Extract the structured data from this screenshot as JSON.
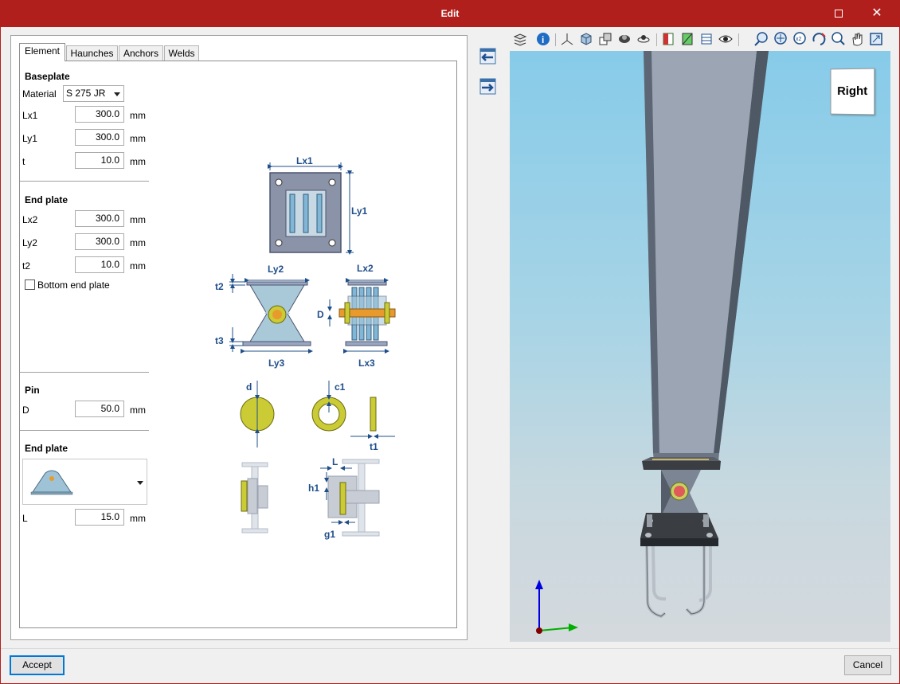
{
  "window": {
    "title": "Edit"
  },
  "tabs": [
    "Element",
    "Haunches",
    "Anchors",
    "Welds"
  ],
  "baseplate": {
    "title": "Baseplate",
    "material_label": "Material",
    "material_value": "S 275 JR",
    "fields": [
      {
        "label": "Lx1",
        "value": "300.0",
        "unit": "mm"
      },
      {
        "label": "Ly1",
        "value": "300.0",
        "unit": "mm"
      },
      {
        "label": "t",
        "value": "10.0",
        "unit": "mm"
      }
    ]
  },
  "end_plate": {
    "title": "End plate",
    "fields": [
      {
        "label": "Lx2",
        "value": "300.0",
        "unit": "mm"
      },
      {
        "label": "Ly2",
        "value": "300.0",
        "unit": "mm"
      },
      {
        "label": "t2",
        "value": "10.0",
        "unit": "mm"
      }
    ],
    "bottom_label": "Bottom end plate"
  },
  "pin": {
    "title": "Pin",
    "fields": [
      {
        "label": "D",
        "value": "50.0",
        "unit": "mm"
      }
    ]
  },
  "end_plate_shape": {
    "title": "End plate",
    "fields": [
      {
        "label": "L",
        "value": "15.0",
        "unit": "mm"
      }
    ]
  },
  "diagram": {
    "lx1": "Lx1",
    "ly1": "Ly1",
    "ly2": "Ly2",
    "lx2": "Lx2",
    "t2": "t2",
    "t3": "t3",
    "ly3": "Ly3",
    "lx3": "Lx3",
    "d_big": "D",
    "d": "d",
    "c1": "c1",
    "t1": "t1",
    "l": "L",
    "h1": "h1",
    "g1": "g1"
  },
  "viewcube": {
    "label": "Right"
  },
  "buttons": {
    "accept": "Accept",
    "cancel": "Cancel"
  },
  "colors": {
    "titlebar": "#b11f1d",
    "plate": "#a9c9d9",
    "pin": "#e89a2c",
    "washer": "#cbcb35",
    "dim": "#1f4f8a"
  }
}
